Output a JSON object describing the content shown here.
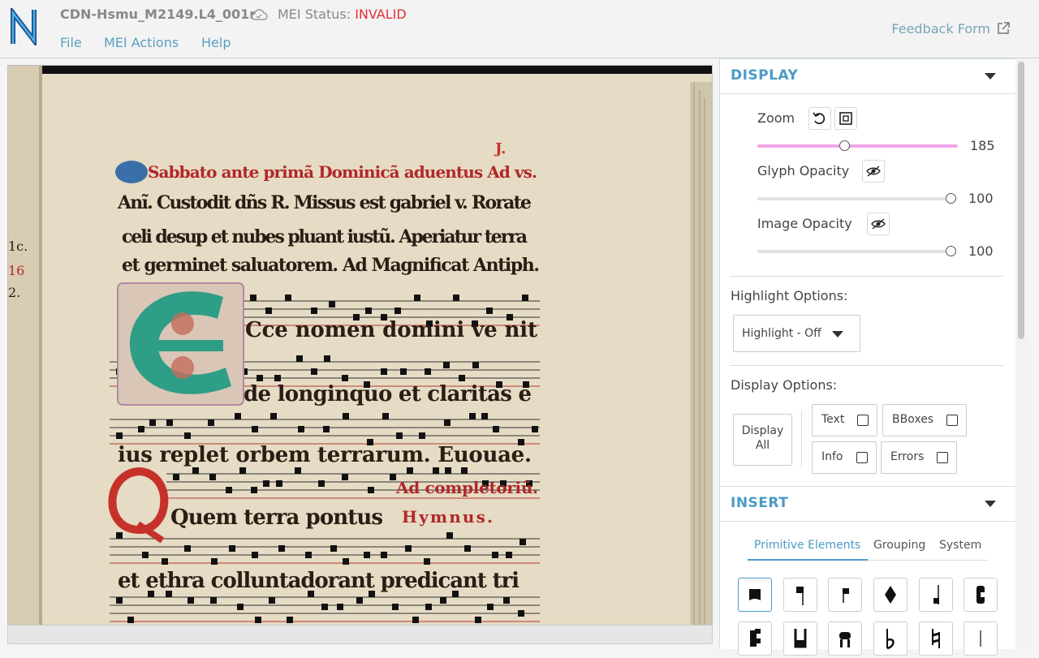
{
  "header": {
    "file_title": "CDN-Hsmu_M2149.L4_001r",
    "mei_status_label": "MEI Status:",
    "mei_status_value": "INVALID",
    "menu": [
      "File",
      "MEI Actions",
      "Help"
    ],
    "feedback": "Feedback Form"
  },
  "manuscript": {
    "folio": "J.",
    "lines": [
      "Sabbato ante primã Dominicã aduentus Ad vs.",
      "Anĩ. Custodit dñs R. Missus est gabriel v. Rorate",
      "celi desup et nubes pluant iustũ. Aperiatur terra",
      "et germinet saluatorem. Ad Magnificat Antiph.",
      "Cce nomen domini ve nit",
      "de longinquo et claritas e",
      "ius replet orbem terrarum. Euouae.",
      "Ad completoriũ.",
      "Quem terra pontus",
      "Hymnus.",
      "et ethra colluntadorant predicant tri"
    ],
    "margin_marks": [
      "1c.",
      "16",
      "2."
    ]
  },
  "display": {
    "title": "DISPLAY",
    "zoom_label": "Zoom",
    "zoom_value": "185",
    "zoom_fraction": 0.433,
    "glyph_label": "Glyph Opacity",
    "glyph_value": "100",
    "image_label": "Image Opacity",
    "image_value": "100",
    "highlight_label": "Highlight Options:",
    "highlight_value": "Highlight - Off",
    "display_options_label": "Display Options:",
    "display_all_line1": "Display",
    "display_all_line2": "All",
    "options": {
      "text": "Text",
      "bboxes": "BBoxes",
      "info": "Info",
      "errors": "Errors"
    }
  },
  "insert": {
    "title": "INSERT",
    "tabs": [
      "Primitive Elements",
      "Grouping",
      "System"
    ]
  },
  "colors": {
    "accent": "#4b9ac6",
    "invalid": "#e0303c",
    "zoom_track": "#f2a6e8"
  }
}
